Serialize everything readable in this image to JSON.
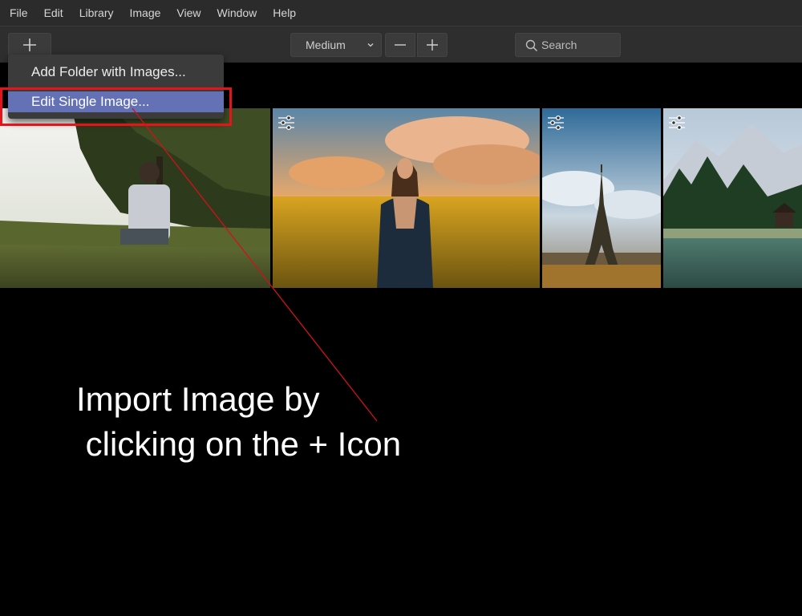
{
  "menubar": {
    "items": [
      "File",
      "Edit",
      "Library",
      "Image",
      "View",
      "Window",
      "Help"
    ]
  },
  "toolbar": {
    "add_icon": "plus-icon",
    "thumbnail_size": "Medium",
    "zoom_out_icon": "minus-icon",
    "zoom_in_icon": "plus-icon",
    "search_placeholder": "Search",
    "search_icon": "search-icon"
  },
  "dropdown": {
    "items": [
      "Add Folder with Images...",
      "Edit Single Image..."
    ],
    "active_index": 1
  },
  "gallery": {
    "thumbnails": [
      {
        "subject": "person-sitting-in-park-photo",
        "has_adjust_icon": false
      },
      {
        "subject": "woman-in-flower-field-photo",
        "has_adjust_icon": true
      },
      {
        "subject": "eiffel-tower-photo",
        "has_adjust_icon": true
      },
      {
        "subject": "mountain-lake-photo",
        "has_adjust_icon": true
      }
    ],
    "adjust_icon": "sliders-icon"
  },
  "annotation": {
    "text_line_1": "Import Image by",
    "text_line_2": " clicking on the + Icon",
    "highlight_color": "#e3141c"
  },
  "colors": {
    "accent": "#6471b4",
    "menubar_bg": "#2b2b2b",
    "toolbar_bg": "#2e2e2e"
  }
}
